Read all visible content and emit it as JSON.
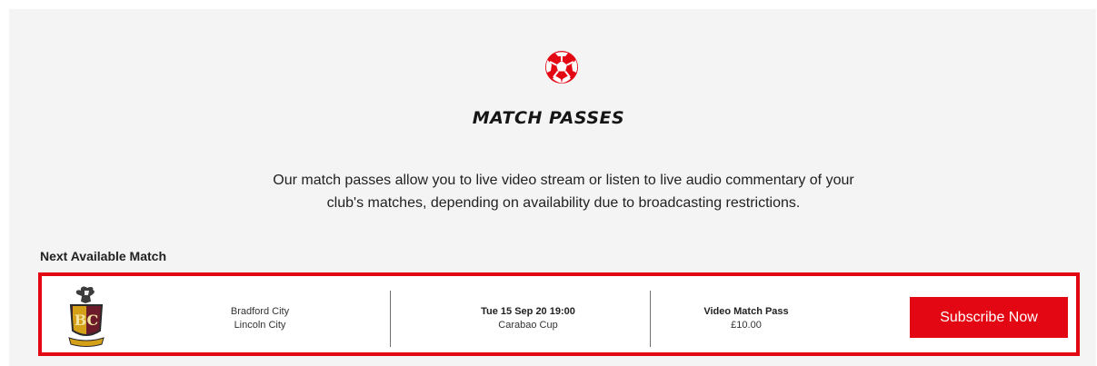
{
  "colors": {
    "brand_red": "#e30613",
    "panel_bg": "#f4f4f4",
    "text_dark": "#222222"
  },
  "header": {
    "icon": "football-icon",
    "title": "MATCH PASSES"
  },
  "intro": {
    "line1": "Our match passes allow you to live video stream or listen to live audio commentary of your",
    "line2": "club's matches, depending on availability due to broadcasting restrictions."
  },
  "next_match": {
    "label": "Next Available Match",
    "crest_icon": "club-crest-icon",
    "home_team": "Bradford City",
    "away_team": "Lincoln City",
    "datetime": "Tue 15 Sep 20 19:00",
    "competition": "Carabao Cup",
    "pass_name": "Video Match Pass",
    "price": "£10.00",
    "subscribe_label": "Subscribe Now"
  }
}
